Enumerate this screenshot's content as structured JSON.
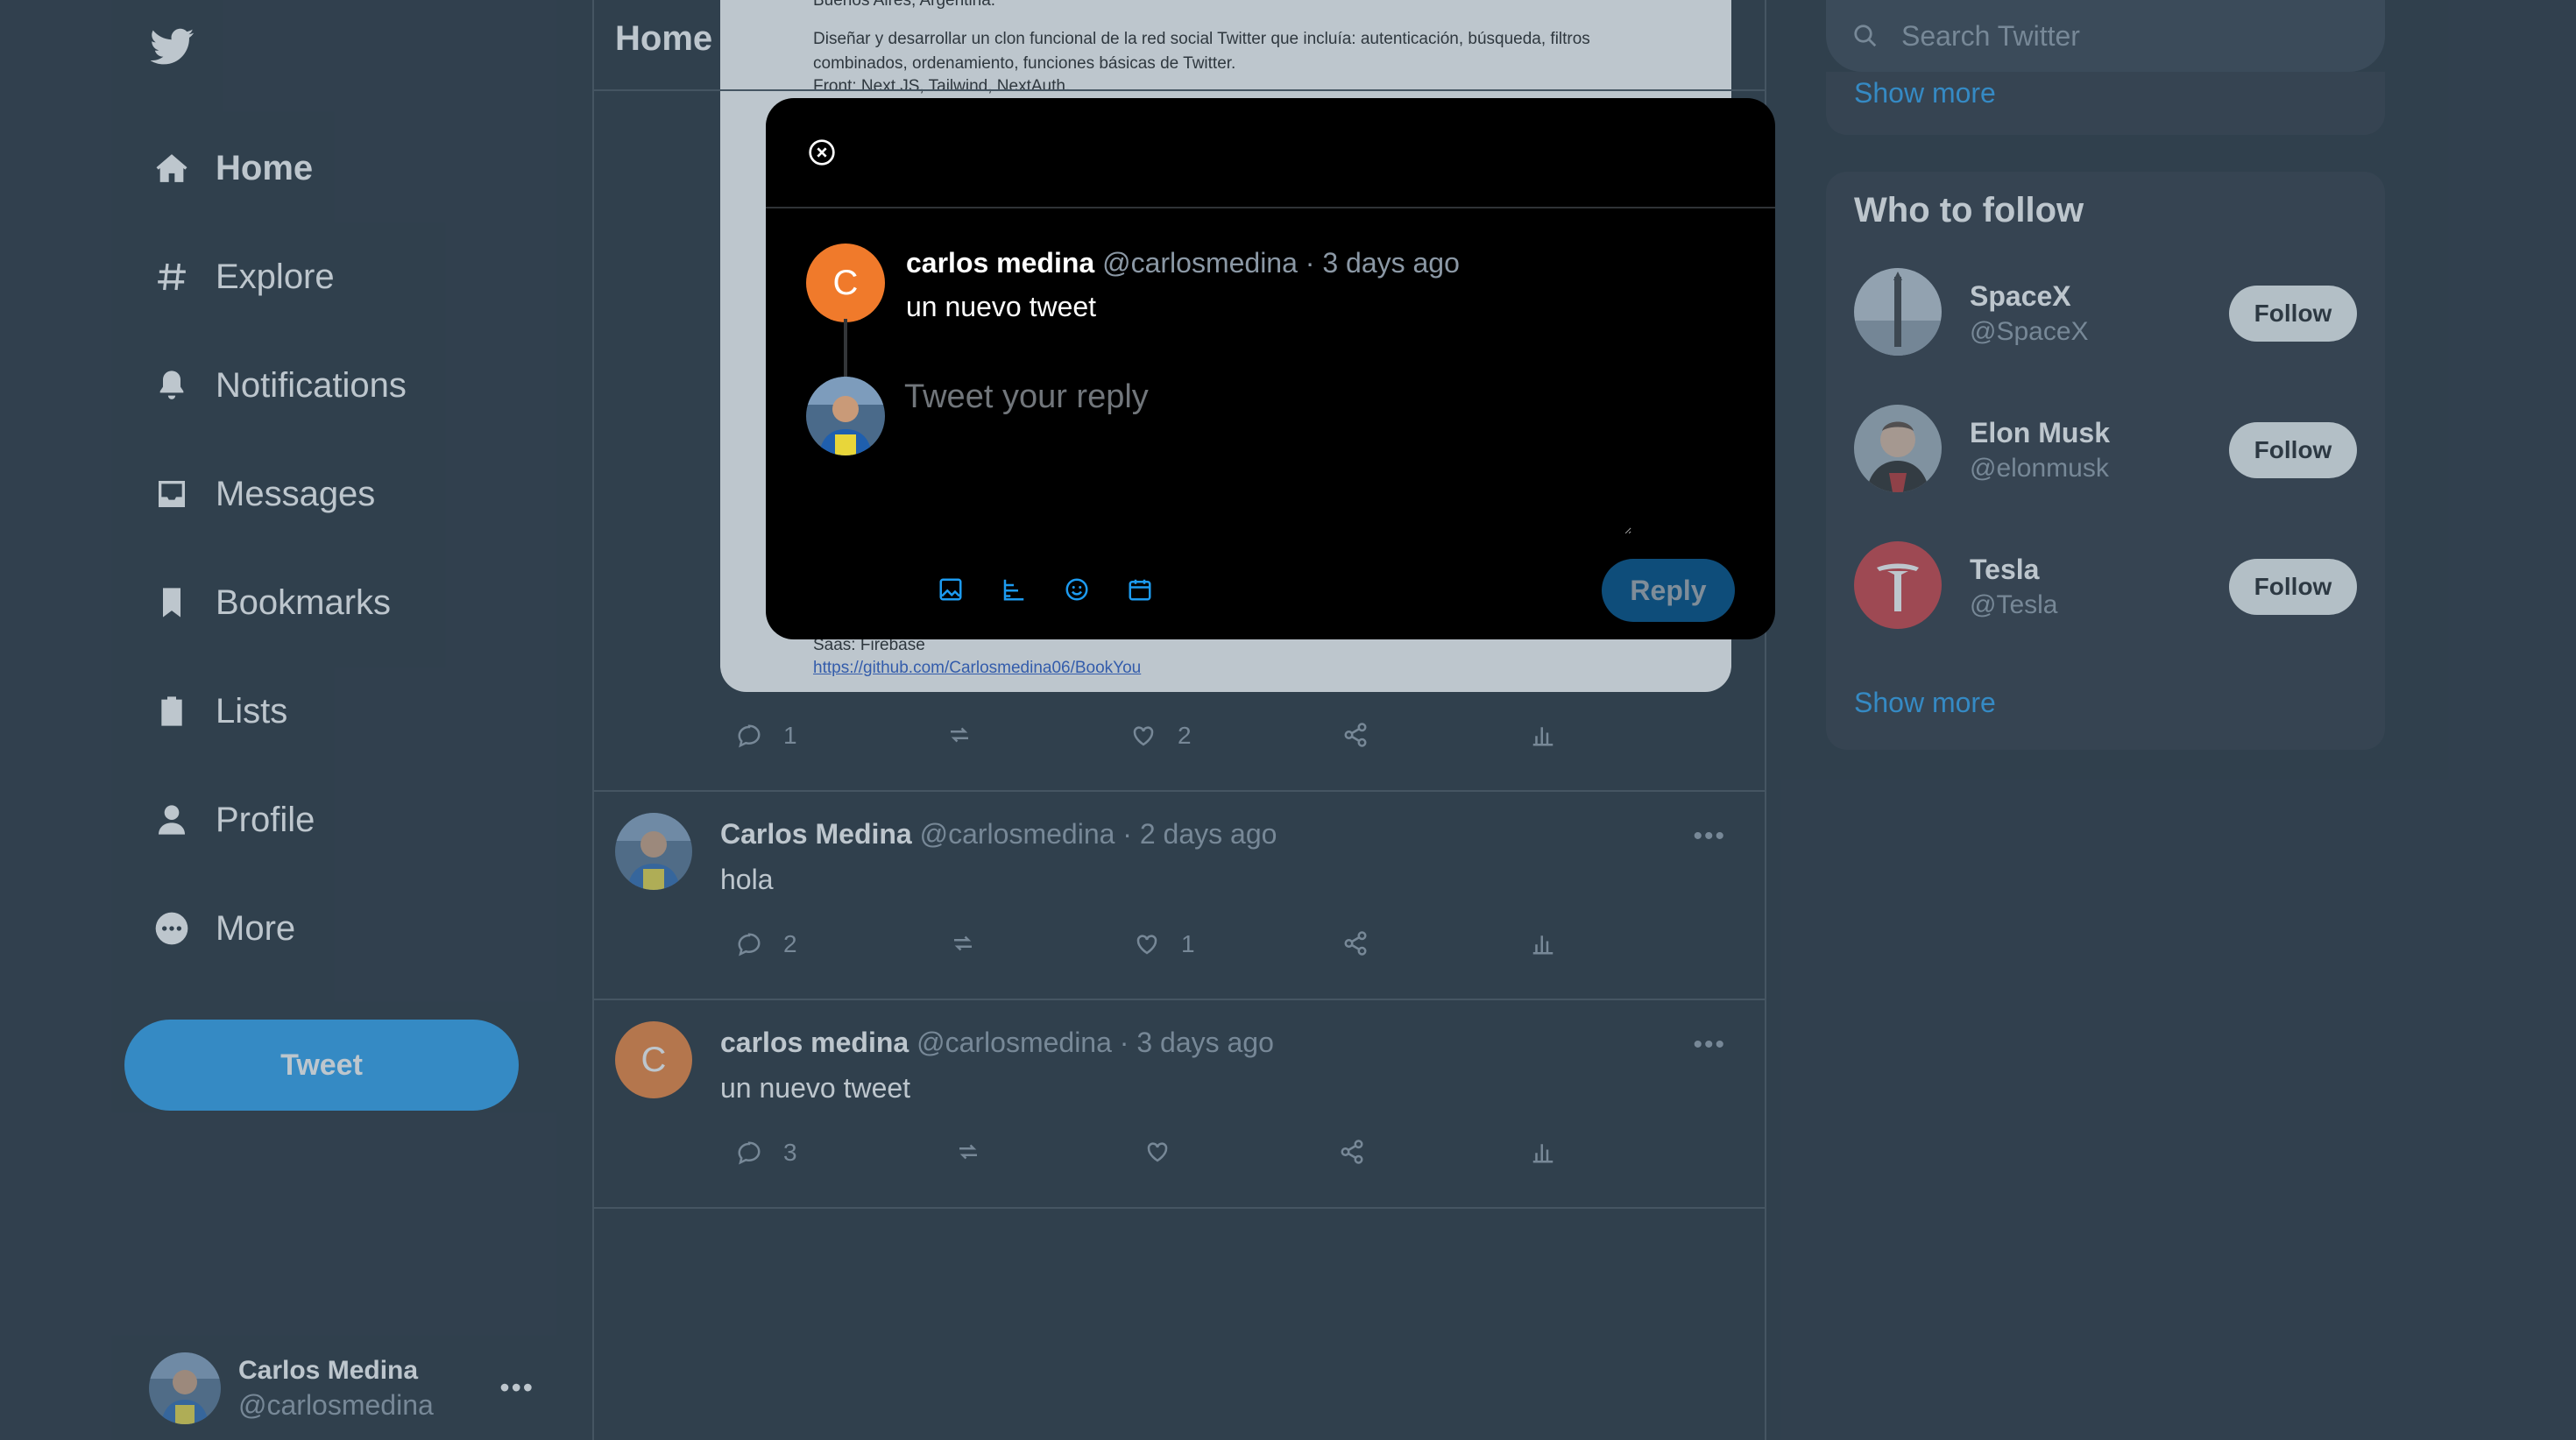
{
  "sidebar": {
    "nav": [
      {
        "label": "Home",
        "icon": "home-icon"
      },
      {
        "label": "Explore",
        "icon": "hashtag-icon"
      },
      {
        "label": "Notifications",
        "icon": "bell-icon"
      },
      {
        "label": "Messages",
        "icon": "inbox-icon"
      },
      {
        "label": "Bookmarks",
        "icon": "bookmark-icon"
      },
      {
        "label": "Lists",
        "icon": "clipboard-icon"
      },
      {
        "label": "Profile",
        "icon": "user-icon"
      },
      {
        "label": "More",
        "icon": "more-circle-icon"
      }
    ],
    "tweet_button": "Tweet",
    "account": {
      "name": "Carlos Medina",
      "handle": "@carlosmedina"
    }
  },
  "main": {
    "title": "Home",
    "doc_image_lines": [
      "Buenos Aires, Argentina.",
      "Diseñar y desarrollar un clon funcional de la red social Twitter que incluía: autenticación, búsqueda, filtros",
      "combinados, ordenamiento, funciones básicas de Twitter.",
      "Front: Next.JS, Tailwind, NextAuth.",
      "Saas: Firebase",
      "https://github.com/Carlosmedina06/BookYou"
    ],
    "first_tweet_actions": {
      "replies": "1",
      "retweets": "",
      "likes": "2"
    },
    "tweets": [
      {
        "name": "Carlos Medina",
        "handle": "@carlosmedina",
        "time": "2 days ago",
        "text": "hola",
        "replies": "2",
        "retweets": "",
        "likes": "1"
      },
      {
        "name": "carlos medina",
        "handle": "@carlosmedina",
        "time": "3 days ago",
        "text": "un nuevo tweet",
        "replies": "3",
        "retweets": "",
        "likes": "",
        "avatar_letter": "C"
      }
    ]
  },
  "right": {
    "search_placeholder": "Search Twitter",
    "trends_show_more": "Show more",
    "who_to_follow": {
      "title": "Who to follow",
      "follow_label": "Follow",
      "accounts": [
        {
          "name": "SpaceX",
          "handle": "@SpaceX"
        },
        {
          "name": "Elon Musk",
          "handle": "@elonmusk"
        },
        {
          "name": "Tesla",
          "handle": "@Tesla"
        }
      ],
      "show_more": "Show more"
    }
  },
  "modal": {
    "original": {
      "avatar_letter": "C",
      "name": "carlos medina",
      "handle": "@carlosmedina",
      "time": "3 days ago",
      "text": "un nuevo tweet"
    },
    "reply_placeholder": "Tweet your reply",
    "reply_button": "Reply"
  },
  "colors": {
    "accent": "#1d9bf0",
    "background": "#15202b",
    "modal": "#000000",
    "orange_avatar": "#f07a2b",
    "tesla_red": "#cc2f35"
  }
}
